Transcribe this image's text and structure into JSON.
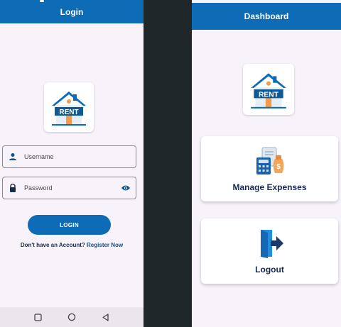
{
  "login_screen": {
    "title": "Login",
    "logo_text": "RENT",
    "username": {
      "placeholder": "Username",
      "value": ""
    },
    "password": {
      "placeholder": "Password",
      "value": ""
    },
    "login_button": "LOGIN",
    "register_prompt": "Don't have an Account?",
    "register_link": "Register Now",
    "nav": [
      "recents-icon",
      "home-icon",
      "back-icon"
    ]
  },
  "dashboard_screen": {
    "title": "Dashboard",
    "logo_text": "RENT",
    "cards": [
      {
        "label": "Manage Expenses",
        "icon": "expenses-icon"
      },
      {
        "label": "Logout",
        "icon": "logout-icon"
      }
    ]
  },
  "colors": {
    "primary": "#0e6bb5",
    "background": "#f8f3fa",
    "divider": "#1f272b",
    "text_dark": "#152a52"
  }
}
